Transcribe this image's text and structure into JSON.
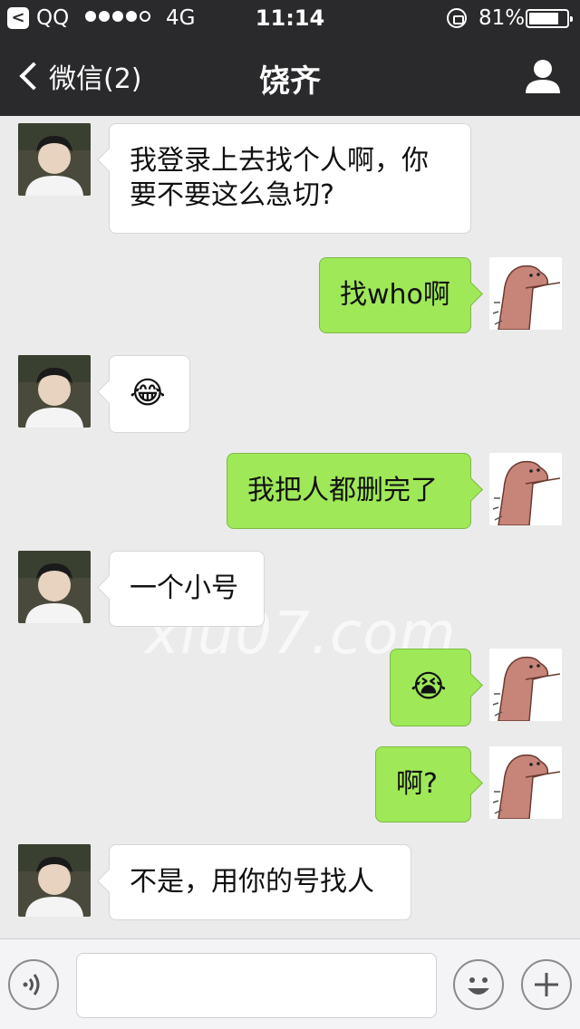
{
  "status_bar": {
    "back_app": "QQ",
    "signal_dots_filled": 4,
    "network": "4G",
    "time": "11:14",
    "battery_percent_label": "81%",
    "battery_level": 0.81
  },
  "nav": {
    "back_label": "微信(2)",
    "title": "饶齐",
    "profile_icon": "person-icon"
  },
  "messages": [
    {
      "side": "in",
      "text": "我登录上去找个人啊，你要不要这么急切?"
    },
    {
      "side": "out",
      "text": "找who啊"
    },
    {
      "side": "in",
      "text": "😂"
    },
    {
      "side": "out",
      "text": "我把人都删完了"
    },
    {
      "side": "in",
      "text": "一个小号"
    },
    {
      "side": "out",
      "text": "😭"
    },
    {
      "side": "out",
      "text": "啊?"
    },
    {
      "side": "in",
      "text": "不是，用你的号找人"
    }
  ],
  "watermark": "xiu07.com",
  "input_bar": {
    "voice_icon": "voice-icon",
    "emoji_icon": "smiley-icon",
    "plus_icon": "plus-icon",
    "placeholder": ""
  },
  "colors": {
    "header_bg": "#2a2a2c",
    "chat_bg": "#ebebeb",
    "outgoing_bubble": "#9fe858",
    "incoming_bubble": "#ffffff"
  }
}
